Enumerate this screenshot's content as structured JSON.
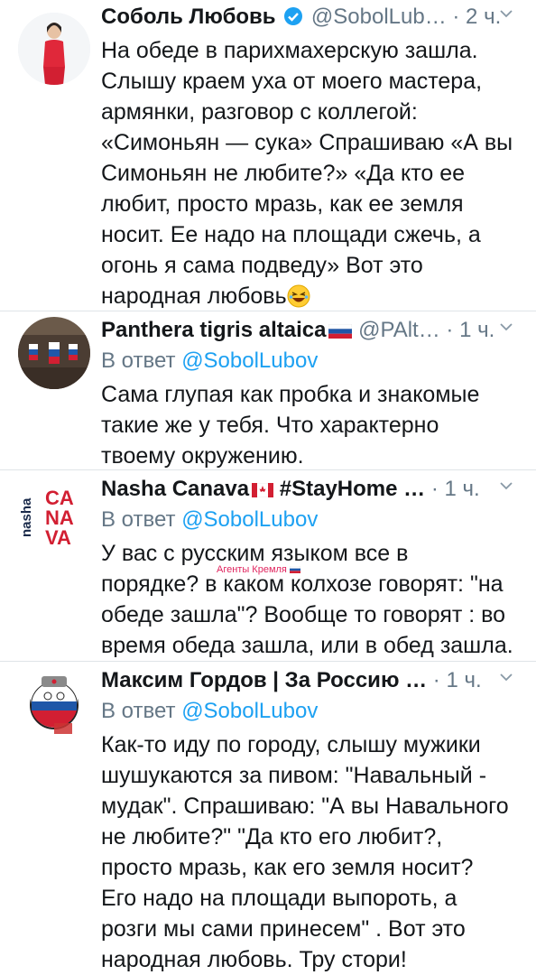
{
  "tweets": [
    {
      "name": "Соболь Любовь",
      "handle": "@SobolLub…",
      "time": "2 ч.",
      "verified": true,
      "text": "На обеде в парихмахерскую зашла.\nСлышу краем уха от моего мастера,\nармянки, разговор с коллегой:\n«Симоньян — сука» Спрашиваю «А вы\nСимоньян не любите?» «Да кто ее\nлюбит, просто мразь, как ее земля\nносит. Ее надо на площади сжечь, а\nогонь я сама подведу» Вот это\nнародная любовь",
      "emoji": "laughing-emoji"
    },
    {
      "name": "Panthera tigris altaica",
      "handle": "@PAlt…",
      "time": "1 ч.",
      "reply_prefix": "В ответ",
      "reply_to": "@SobolLubov",
      "flag": "russia-flag-icon",
      "text": "Сама глупая как пробка и знакомые\nтакие же у тебя. Что характерно\nтвоему окружению."
    },
    {
      "name": "Nasha Canava",
      "name_suffix": "#StayHome …",
      "time": "1 ч.",
      "reply_prefix": "В ответ",
      "reply_to": "@SobolLubov",
      "flag": "canada-flag-icon",
      "avatar_text": "nasha CA NA VA",
      "overlay_label": "Агенты Кремля",
      "text": "У вас с русским языком все в\nпорядке? в каком колхозе говорят: \"на\nобеде зашла\"? Вообще то говорят : во\nвремя обеда зашла, или в обед зашла."
    },
    {
      "name": "Максим Гордов | За Россию …",
      "time": "1 ч.",
      "reply_prefix": "В ответ",
      "reply_to": "@SobolLubov",
      "text": "Как-то иду по городу, слышу мужики\nшушукаются за пивом: \"Навальный -\nмудак\". Спрашиваю: \"А вы Навального\nне любите?\" \"Да кто его любит?,\nпросто мразь, как его земля носит?\nЕго надо на площади выпороть, а\nрозги мы сами принесем\" . Вот это\nнародная любовь. Тру стори!"
    }
  ],
  "colors": {
    "accent": "#1da1f2",
    "muted": "#657786",
    "text": "#14171a",
    "divider": "#dfe4e8"
  }
}
